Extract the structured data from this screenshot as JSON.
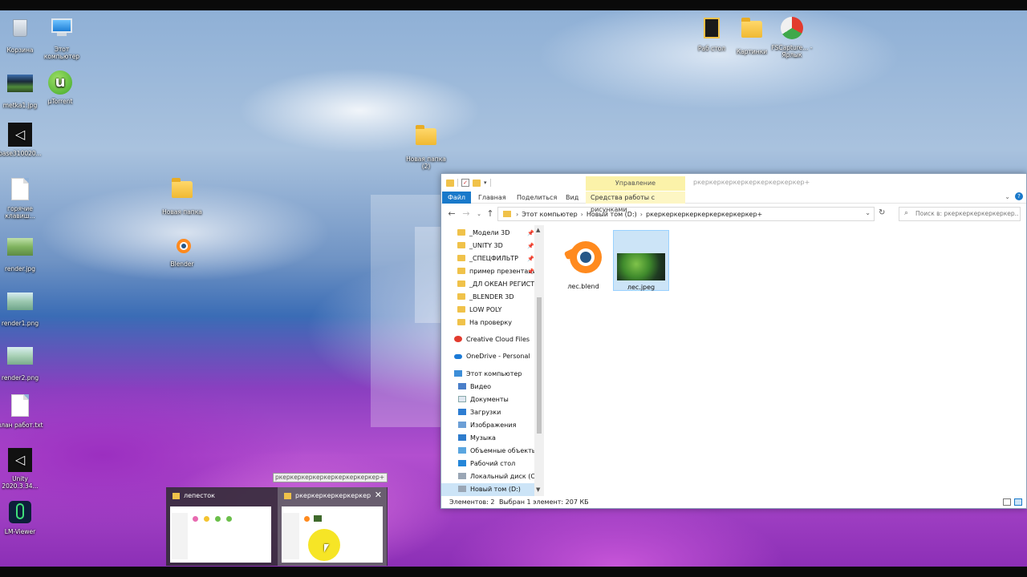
{
  "desktop": {
    "icons": [
      {
        "label": "Корзина",
        "icon": "recycle-bin-icon"
      },
      {
        "label": "Этот компьютер",
        "icon": "computer-icon"
      },
      {
        "label": "metka1.jpg",
        "icon": "image-icon"
      },
      {
        "label": "µTorrent",
        "icon": "utorrent-icon"
      },
      {
        "label": "base310020...",
        "icon": "unity-icon"
      },
      {
        "label": "горячие клавиш...",
        "icon": "text-file-icon"
      },
      {
        "label": "Новая папка",
        "icon": "folder-icon"
      },
      {
        "label": "Blender",
        "icon": "blender-icon"
      },
      {
        "label": "render.jpg",
        "icon": "image-icon"
      },
      {
        "label": "render1.png",
        "icon": "image-icon"
      },
      {
        "label": "render2.png",
        "icon": "image-icon"
      },
      {
        "label": "план работ.txt",
        "icon": "text-file-icon"
      },
      {
        "label": "Unity 2020.3.34...",
        "icon": "unity-icon"
      },
      {
        "label": "LM-Viewer",
        "icon": "lm-viewer-icon"
      },
      {
        "label": "Новая папка (2)",
        "icon": "folder-icon"
      },
      {
        "label": "Раб стол",
        "icon": "folder-icon"
      },
      {
        "label": "Картинки",
        "icon": "folder-icon"
      },
      {
        "label": "FSCapture... - Ярлык",
        "icon": "fscapture-icon"
      }
    ]
  },
  "explorer": {
    "manage_tab": "Управление",
    "title": "ркеркеркеркеркеркеркеркеркер+",
    "ribbon_tabs": [
      "Файл",
      "Главная",
      "Поделиться",
      "Вид",
      "Средства работы с рисунками"
    ],
    "address": {
      "crumbs": [
        "Этот компьютер",
        "Новый том (D:)",
        "ркеркеркеркеркеркеркеркеркер+"
      ],
      "search_placeholder": "Поиск в: ркеркеркеркеркеркер..."
    },
    "nav": {
      "quick": [
        {
          "label": "_Модели 3D",
          "pinned": true
        },
        {
          "label": "_UNITY 3D",
          "pinned": true
        },
        {
          "label": "_СПЕЦФИЛЬТР",
          "pinned": true
        },
        {
          "label": "пример презентаци",
          "pinned": true
        },
        {
          "label": "_ДЛ ОКЕАН РЕГИСТРА",
          "pinned": false
        },
        {
          "label": "_BLENDER 3D",
          "pinned": false
        },
        {
          "label": "LOW POLY",
          "pinned": false
        },
        {
          "label": "На проверку",
          "pinned": false
        }
      ],
      "creative_cloud": "Creative Cloud Files",
      "onedrive": "OneDrive - Personal",
      "this_pc": "Этот компьютер",
      "pc_items": [
        "Видео",
        "Документы",
        "Загрузки",
        "Изображения",
        "Музыка",
        "Объемные объекты",
        "Рабочий стол",
        "Локальный диск (C:)",
        "Новый том (D:)"
      ]
    },
    "files": [
      {
        "name": "лес.blend",
        "icon": "blender-icon",
        "selected": false
      },
      {
        "name": "лес.jpeg",
        "icon": "image-thumbnail",
        "selected": true
      }
    ],
    "status": {
      "count": "Элементов: 2",
      "selected": "Выбран 1 элемент: 207 КБ"
    }
  },
  "taskbar_preview": {
    "tooltip": "ркеркеркеркеркеркеркеркеркер+",
    "windows": [
      {
        "title": "лепесток"
      },
      {
        "title": "ркеркеркеркеркеркер..."
      }
    ]
  }
}
